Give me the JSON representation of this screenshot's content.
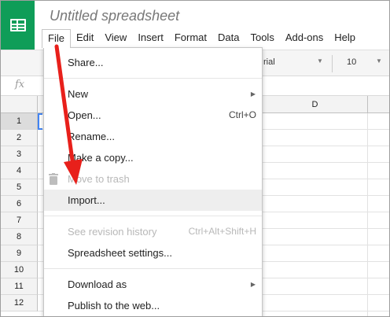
{
  "app": {
    "title": "Untitled spreadsheet",
    "logo_icon": "sheets-logo-icon",
    "brand_color": "#0f9d58"
  },
  "menubar": {
    "items": [
      "File",
      "Edit",
      "View",
      "Insert",
      "Format",
      "Data",
      "Tools",
      "Add-ons",
      "Help"
    ],
    "active": "File"
  },
  "toolbar": {
    "font": "rial",
    "font_size": "10"
  },
  "formula_bar": {
    "fx_label": "fx"
  },
  "grid": {
    "visible_column": "D",
    "rows": [
      "1",
      "2",
      "3",
      "4",
      "5",
      "6",
      "7",
      "8",
      "9",
      "10",
      "11",
      "12"
    ],
    "selected_row": "1",
    "selection_color": "#4285f4"
  },
  "file_menu": {
    "items": [
      {
        "label": "Share...",
        "shortcut": "",
        "submenu": false,
        "disabled": false
      },
      {
        "label": "New",
        "shortcut": "",
        "submenu": true,
        "disabled": false
      },
      {
        "label": "Open...",
        "shortcut": "Ctrl+O",
        "submenu": false,
        "disabled": false
      },
      {
        "label": "Rename...",
        "shortcut": "",
        "submenu": false,
        "disabled": false
      },
      {
        "label": "Make a copy...",
        "shortcut": "",
        "submenu": false,
        "disabled": false
      },
      {
        "label": "Move to trash",
        "shortcut": "",
        "submenu": false,
        "disabled": true,
        "icon": "trash-icon"
      },
      {
        "label": "Import...",
        "shortcut": "",
        "submenu": false,
        "disabled": false,
        "highlighted": true
      },
      {
        "label": "See revision history",
        "shortcut": "Ctrl+Alt+Shift+H",
        "submenu": false,
        "disabled": true
      },
      {
        "label": "Spreadsheet settings...",
        "shortcut": "",
        "submenu": false,
        "disabled": false
      },
      {
        "label": "Download as",
        "shortcut": "",
        "submenu": true,
        "disabled": false
      },
      {
        "label": "Publish to the web...",
        "shortcut": "",
        "submenu": false,
        "disabled": false
      }
    ],
    "submenu_icon": "triangle-right-icon"
  },
  "annotation": {
    "arrow_color": "#e8201b",
    "arrow_icon": "red-arrow-annotation"
  }
}
